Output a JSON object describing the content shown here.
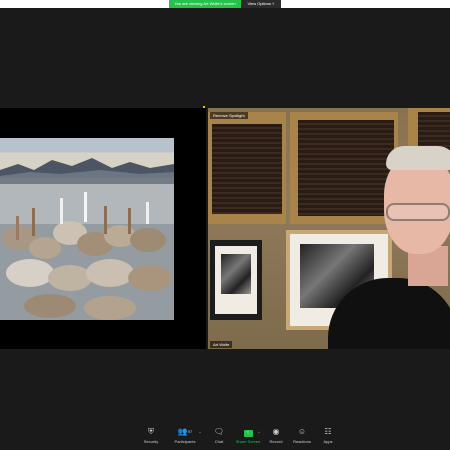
{
  "top": {
    "share_banner": "You are viewing Art Wolfe's screen",
    "view_options": "View Options ˅"
  },
  "speaker": {
    "spotlight_label": "Remove Spotlight",
    "name_label": "Art Wolfe"
  },
  "toolbar": {
    "security": "Security",
    "participants": "Participants",
    "participants_count": "97",
    "chat": "Chat",
    "share": "Share Screen",
    "record": "Record",
    "reactions": "Reactions",
    "apps": "Apps"
  },
  "icons": {
    "security": "shield-icon",
    "participants": "people-icon",
    "chat": "chat-bubble-icon",
    "share": "share-arrow-icon",
    "record": "record-circle-icon",
    "reactions": "emoji-icon",
    "apps": "apps-icon"
  },
  "colors": {
    "accent_green": "#27c24c",
    "background": "#1a1a1a"
  }
}
